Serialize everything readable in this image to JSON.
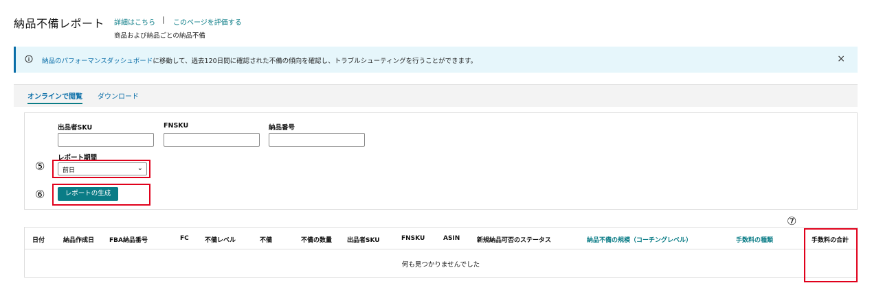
{
  "header": {
    "title": "納品不備レポート",
    "details_link": "詳細はこちら",
    "separator": "|",
    "rate_link": "このページを評価する",
    "subtitle": "商品および納品ごとの納品不備"
  },
  "banner": {
    "link_text": "納品のパフォーマンスダッシュボード",
    "message_rest": "に移動して、過去120日間に確認された不備の傾向を確認し、トラブルシューティングを行うことができます。",
    "close": "×"
  },
  "tabs": [
    {
      "label": "オンラインで閲覧",
      "active": true
    },
    {
      "label": "ダウンロード",
      "active": false
    }
  ],
  "form": {
    "seller_sku_label": "出品者SKU",
    "seller_sku_value": "",
    "fnsku_label": "FNSKU",
    "fnsku_value": "",
    "shipment_id_label": "納品番号",
    "shipment_id_value": "",
    "period_label": "レポート期間",
    "period_value": "前日",
    "generate_button": "レポートの生成"
  },
  "annotations": {
    "mark5": "⑤",
    "mark6": "⑥",
    "mark7": "⑦"
  },
  "table": {
    "columns": [
      {
        "label": "日付",
        "link": false
      },
      {
        "label": "納品作成日",
        "link": false
      },
      {
        "label": "FBA納品番号",
        "link": false
      },
      {
        "label": "FC",
        "link": false
      },
      {
        "label": "不備レベル",
        "link": false
      },
      {
        "label": "不備",
        "link": false
      },
      {
        "label": "不備の数量",
        "link": false
      },
      {
        "label": "出品者SKU",
        "link": false
      },
      {
        "label": "FNSKU",
        "link": false
      },
      {
        "label": "ASIN",
        "link": false
      },
      {
        "label": "新規納品可否のステータス",
        "link": false
      },
      {
        "label": "納品不備の規模（コーチングレベル）",
        "link": true
      },
      {
        "label": "手数料の種類",
        "link": true
      },
      {
        "label": "手数料の合計",
        "link": false
      }
    ],
    "empty_message": "何も見つかりませんでした"
  },
  "colors": {
    "accent_teal": "#0a7c86",
    "link_blue": "#0a6ea8",
    "banner_bg": "#e6f6fb",
    "annotation_red": "#e0001b"
  }
}
